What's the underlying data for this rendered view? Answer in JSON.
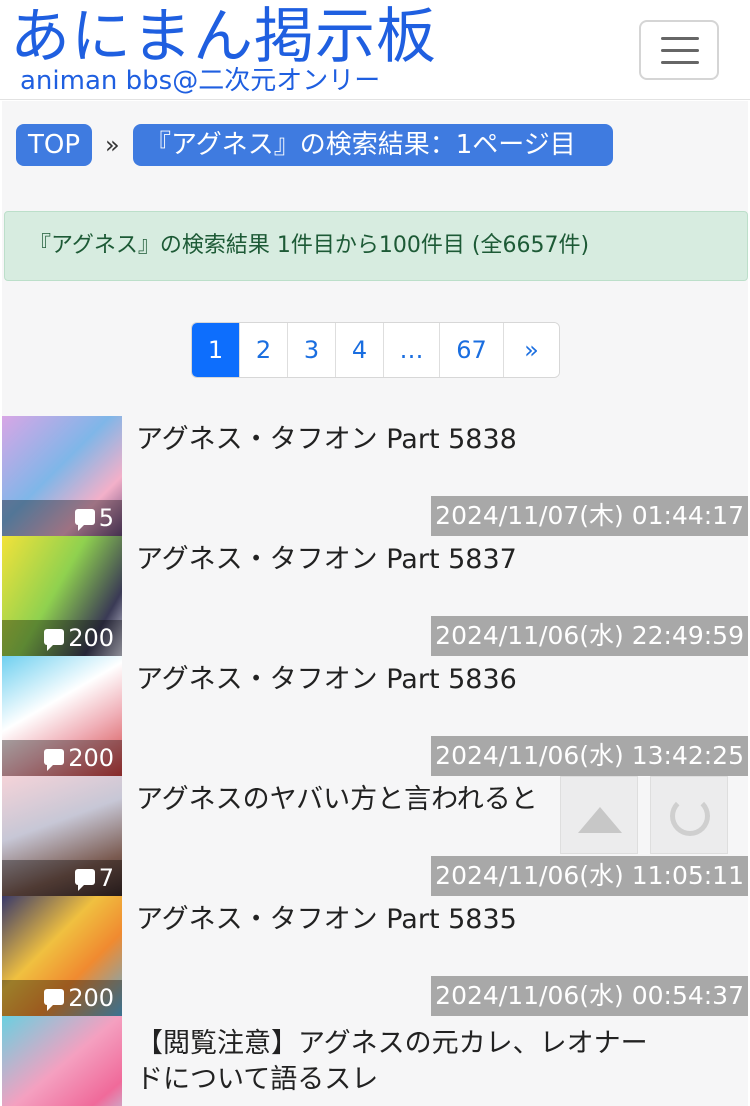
{
  "header": {
    "title": "あにまん掲示板",
    "subtitle": "animan bbs@二次元オンリー",
    "menu_icon": "hamburger-icon"
  },
  "breadcrumb": {
    "top": "TOP",
    "separator": "»",
    "current": "『アグネス』の検索結果：1ページ目"
  },
  "alert": {
    "text": "『アグネス』の検索結果 1件目から100件目 (全6657件)"
  },
  "pagination": {
    "pages": [
      "1",
      "2",
      "3",
      "4",
      "…",
      "67",
      "»"
    ],
    "active": "1"
  },
  "threads": [
    {
      "title": "アグネス・タフオン Part 5838",
      "count": "5",
      "date": "2024/11/07(木) 01:44:17"
    },
    {
      "title": "アグネス・タフオン Part 5837",
      "count": "200",
      "date": "2024/11/06(水) 22:49:59"
    },
    {
      "title": "アグネス・タフオン Part 5836",
      "count": "200",
      "date": "2024/11/06(水) 13:42:25"
    },
    {
      "title": "アグネスのヤバい方と言われると",
      "count": "7",
      "date": "2024/11/06(水) 11:05:11"
    },
    {
      "title": "アグネス・タフオン Part 5835",
      "count": "200",
      "date": "2024/11/06(水) 00:54:37"
    },
    {
      "title": "【閲覧注意】アグネスの元カレ、レオナードについて語るスレ",
      "count": "",
      "date": ""
    }
  ],
  "floating": {
    "scroll_top_icon": "arrow-up-icon",
    "refresh_icon": "refresh-icon"
  },
  "colors": {
    "brand": "#1f5fe0",
    "crumb": "#3f7be0",
    "active_page": "#0d6efd",
    "alert_bg": "#d7ece0",
    "date_bg": "#a8a8a8"
  }
}
